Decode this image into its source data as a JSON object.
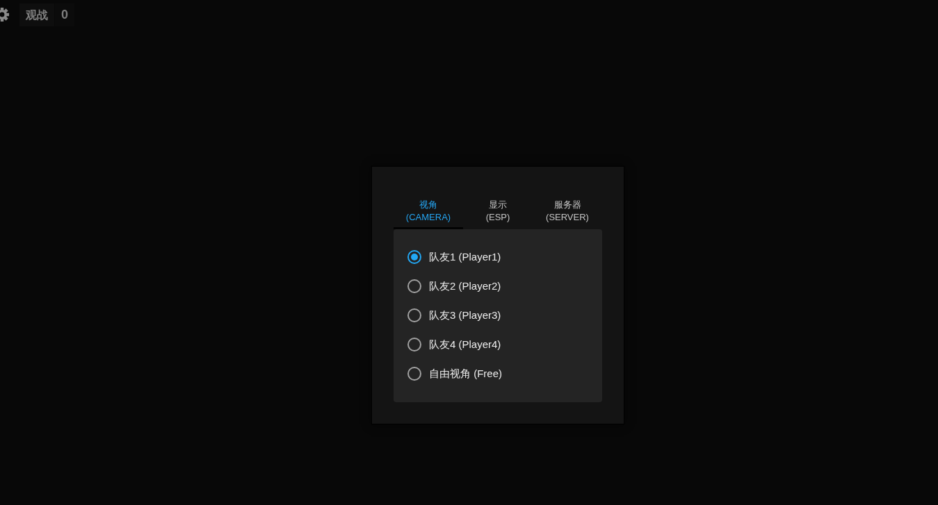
{
  "top_bar": {
    "spectate_label": "观战",
    "spectator_count": "0"
  },
  "panel": {
    "tabs": [
      {
        "label": "视角",
        "sublabel": "(CAMERA)",
        "selected": true
      },
      {
        "label": "显示",
        "sublabel": "(ESP)",
        "selected": false
      },
      {
        "label": "服务器",
        "sublabel": "(SERVER)",
        "selected": false
      }
    ],
    "options": [
      {
        "label": "队友1 (Player1)",
        "selected": true
      },
      {
        "label": "队友2 (Player2)",
        "selected": false
      },
      {
        "label": "队友3 (Player3)",
        "selected": false
      },
      {
        "label": "队友4 (Player4)",
        "selected": false
      },
      {
        "label": "自由视角 (Free)",
        "selected": false
      }
    ]
  }
}
